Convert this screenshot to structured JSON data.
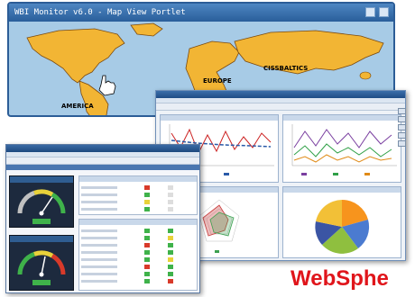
{
  "map_portlet": {
    "title": "WBI Monitor v6.0 - Map View Portlet",
    "regions": {
      "america": "AMERICA",
      "europe": "EUROPE",
      "cis": "CISSBALTICS"
    }
  },
  "brand": {
    "text": "WebSphe"
  },
  "colors": {
    "ocean": "#a7cbe6",
    "land": "#f2b534",
    "titlebar": "#2c5d97",
    "brand_red": "#e0151b"
  },
  "icons": [
    "minimize-icon",
    "maximize-icon",
    "hand-cursor-icon"
  ]
}
